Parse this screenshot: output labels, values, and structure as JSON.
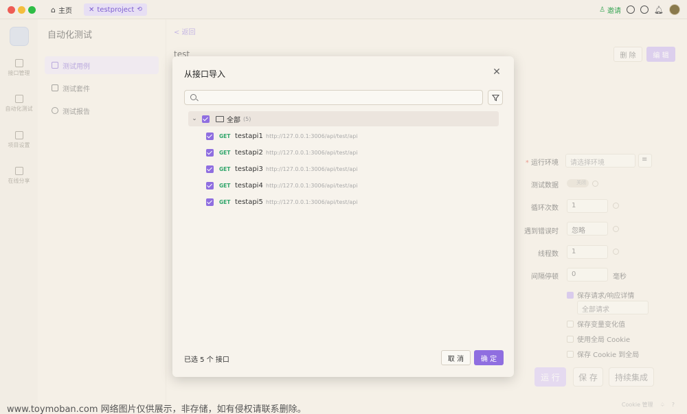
{
  "titlebar": {
    "home_label": "主页",
    "project_tab": "testproject",
    "invite_label": "邀请"
  },
  "rail": {
    "items": [
      "接口管理",
      "自动化测试",
      "项目设置",
      "在线分享"
    ]
  },
  "sidepanel": {
    "title": "自动化测试",
    "items": [
      "测试用例",
      "测试套件",
      "测试报告"
    ]
  },
  "main": {
    "back_label": "< 返回",
    "title": "test",
    "delete_label": "删 除",
    "edit_label": "编 辑",
    "form": {
      "env_label": "运行环境",
      "env_placeholder": "请选择环境",
      "test_data_label": "测试数据",
      "test_data_toggle": "关闭",
      "loop_label": "循环次数",
      "loop_value": "1",
      "on_error_label": "遇到错误时",
      "on_error_value": "忽略",
      "threads_label": "线程数",
      "threads_value": "1",
      "interval_label": "间隔停顿",
      "interval_value": "0",
      "interval_unit": "毫秒",
      "save_detail_label": "保存请求/响应详情",
      "save_detail_select": "全部请求",
      "save_vars_label": "保存变量变化值",
      "global_cookie_label": "使用全局 Cookie",
      "save_cookie_label": "保存 Cookie 到全局"
    },
    "run_label": "运 行",
    "save_label": "保 存",
    "ci_label": "持续集成",
    "cookie_mgr_label": "Cookie 管理"
  },
  "modal": {
    "title": "从接口导入",
    "search_placeholder": "",
    "root": {
      "label": "全部",
      "count": "(5)"
    },
    "apis": [
      {
        "method": "GET",
        "name": "testapi1",
        "url": "http://127.0.0.1:3006/api/test/api"
      },
      {
        "method": "GET",
        "name": "testapi2",
        "url": "http://127.0.0.1:3006/api/test/api"
      },
      {
        "method": "GET",
        "name": "testapi3",
        "url": "http://127.0.0.1:3006/api/test/api"
      },
      {
        "method": "GET",
        "name": "testapi4",
        "url": "http://127.0.0.1:3006/api/test/api"
      },
      {
        "method": "GET",
        "name": "testapi5",
        "url": "http://127.0.0.1:3006/api/test/api"
      }
    ],
    "selected_text": "已选 5 个 接口",
    "cancel_label": "取 消",
    "ok_label": "确 定"
  },
  "watermark": "www.toymoban.com 网络图片仅供展示，非存储，如有侵权请联系删除。",
  "colors": {
    "accent": "#8f6ee0",
    "method_get": "#2fa56a",
    "invite": "#3aa657"
  }
}
